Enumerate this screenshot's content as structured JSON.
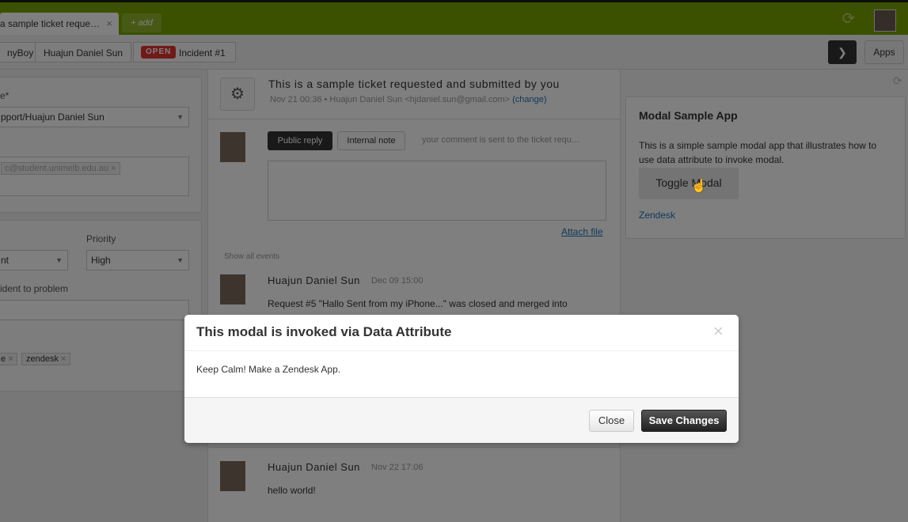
{
  "topbar": {
    "tab_label": "a sample ticket reque…",
    "tab_close": "×",
    "add_label": "+ add",
    "sync_icon": "refresh-icon"
  },
  "breadcrumbs": {
    "org": "nyBoy",
    "requester": "Huajun Daniel Sun",
    "status": "OPEN",
    "ticket": "Incident #1"
  },
  "toolbar": {
    "apps_label": "Apps",
    "next_icon": "chevron-right-icon"
  },
  "left": {
    "requester_label": "e*",
    "requester_value": "pport/Huajun Daniel Sun",
    "cc_value": "c@student.unimelb.edu.au",
    "priority_label": "Priority",
    "type_value": "nt",
    "priority_value": "High",
    "link_label": "ident to problem",
    "tags": [
      "e",
      "zendesk"
    ]
  },
  "ticket": {
    "subject": "This is a sample ticket requested and submitted by you",
    "meta_date": "Nov 21 00:36",
    "meta_from": "Huajun Daniel Sun <hjdaniel.sun@gmail.com>",
    "meta_change": "(change)",
    "public_reply": "Public reply",
    "internal_note": "Internal note",
    "reply_hint": "your comment is sent to the ticket requ…",
    "attach_file": "Attach file",
    "show_all": "Show all events",
    "events": [
      {
        "author": "Huajun Daniel Sun",
        "time": "Dec 09 15:00",
        "body": "Request #5 \"Hallo Sent from my iPhone...\" was closed and merged into"
      },
      {
        "author": "Huajun Daniel Sun",
        "time": "Nov 22 17:06",
        "body": "hello world!"
      }
    ]
  },
  "app": {
    "title": "Modal Sample App",
    "description": "This is a simple sample modal app that illustrates how to use data attribute to invoke modal.",
    "toggle_label": "Toggle Modal",
    "link": "Zendesk"
  },
  "modal": {
    "title": "This modal is invoked via Data Attribute",
    "body": "Keep Calm! Make a Zendesk App.",
    "close_x": "×",
    "close_label": "Close",
    "save_label": "Save Changes"
  }
}
